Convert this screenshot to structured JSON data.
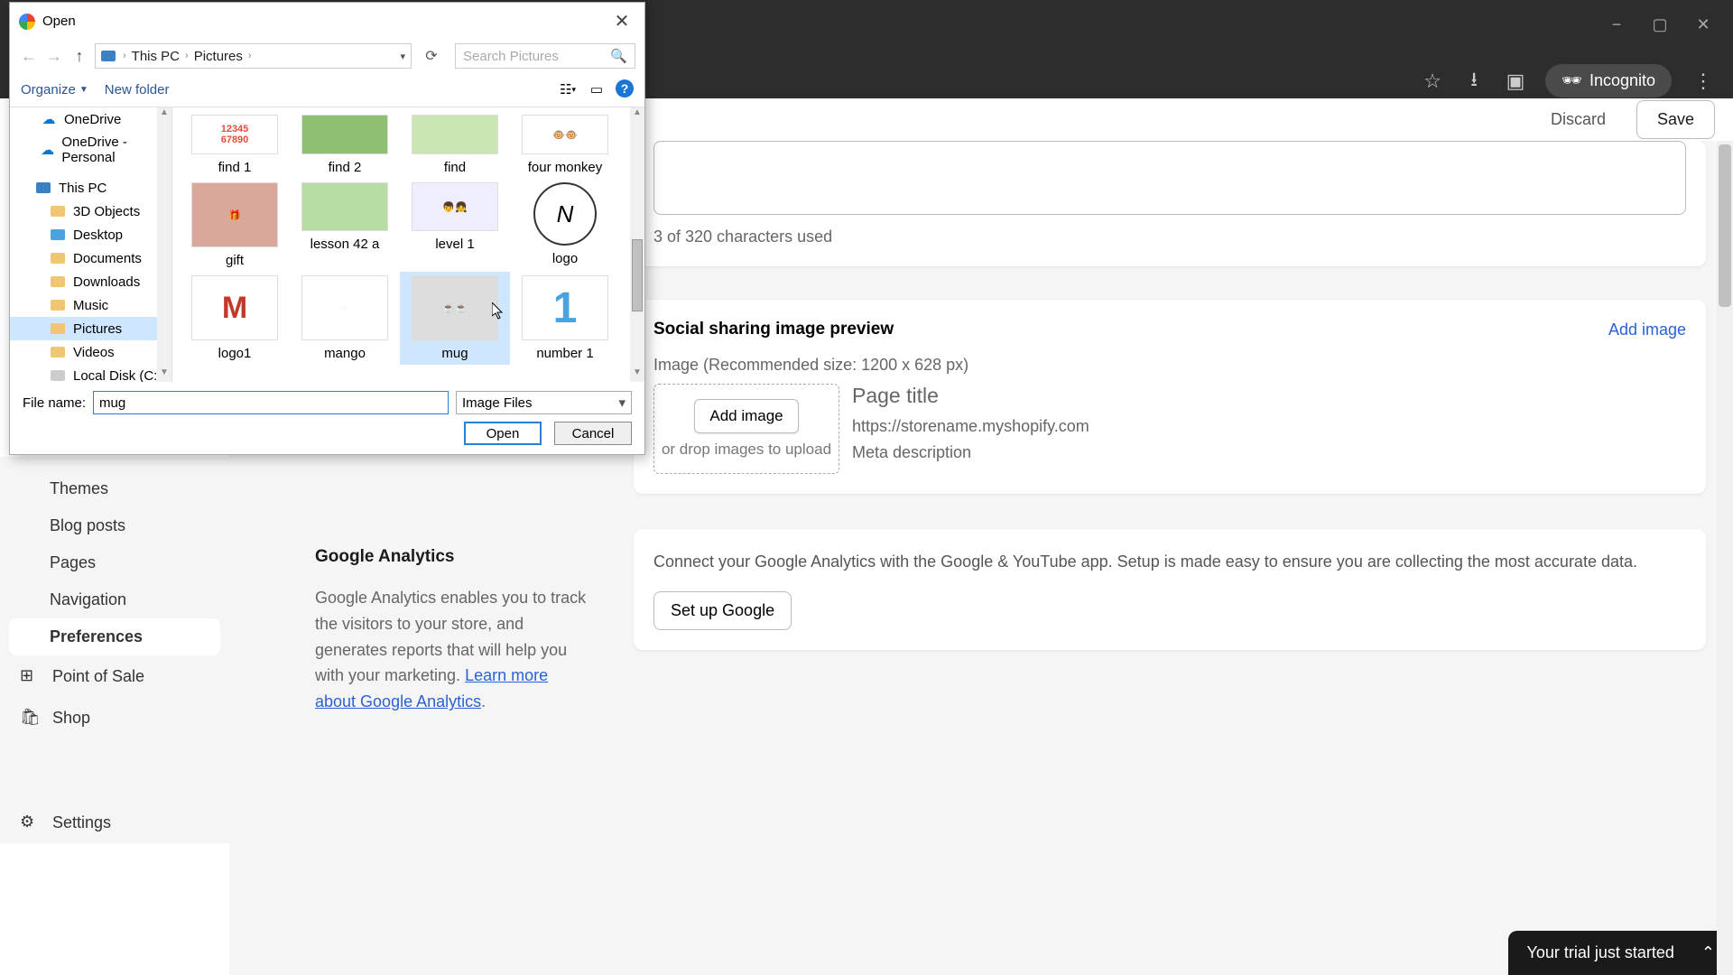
{
  "browser": {
    "incognito_label": "Incognito",
    "window": {
      "minimize": "−",
      "maximize": "▢",
      "close": "✕"
    }
  },
  "top_bar": {
    "discard": "Discard",
    "save": "Save"
  },
  "char_counter": "3 of 320 characters used",
  "social": {
    "heading": "Social sharing image preview",
    "add_image": "Add image",
    "recommend": "Image   (Recommended size: 1200 x 628 px)",
    "drop_btn": "Add image",
    "drop_hint": "or drop images to upload",
    "preview_title": "Page title",
    "preview_url": "https://storename.myshopify.com",
    "preview_meta": "Meta description"
  },
  "ga_left": {
    "title": "Google Analytics",
    "body_a": "Google Analytics enables you to track the visitors to your store, and generates reports that will help you with your marketing. ",
    "link": "Learn more about Google Analytics",
    "dot": "."
  },
  "ga_card": {
    "body": "Connect your Google Analytics with the Google & YouTube app. Setup is made easy to ensure you are collecting the most accurate data.",
    "btn": "Set up Google"
  },
  "sidebar": {
    "items": [
      "Themes",
      "Blog posts",
      "Pages",
      "Navigation",
      "Preferences"
    ],
    "pos": "Point of Sale",
    "shop": "Shop",
    "settings": "Settings"
  },
  "trial": "Your trial just started",
  "dialog": {
    "title": "Open",
    "breadcrumb": [
      "This PC",
      "Pictures"
    ],
    "search_placeholder": "Search Pictures",
    "toolbar": {
      "organize": "Organize",
      "newfolder": "New folder"
    },
    "tree": [
      {
        "label": "OneDrive",
        "type": "onedrive"
      },
      {
        "label": "OneDrive - Personal",
        "type": "onedrive"
      },
      {
        "label": "This PC",
        "type": "pc"
      },
      {
        "label": "3D Objects",
        "type": "folder"
      },
      {
        "label": "Desktop",
        "type": "folder"
      },
      {
        "label": "Documents",
        "type": "folder"
      },
      {
        "label": "Downloads",
        "type": "folder"
      },
      {
        "label": "Music",
        "type": "folder"
      },
      {
        "label": "Pictures",
        "type": "folder",
        "selected": true
      },
      {
        "label": "Videos",
        "type": "folder"
      },
      {
        "label": "Local Disk (C:)",
        "type": "disk"
      }
    ],
    "files": [
      {
        "name": "find 1"
      },
      {
        "name": "find 2"
      },
      {
        "name": "find"
      },
      {
        "name": "four monkey"
      },
      {
        "name": "gift"
      },
      {
        "name": "lesson 42 a"
      },
      {
        "name": "level 1"
      },
      {
        "name": "logo"
      },
      {
        "name": "logo1"
      },
      {
        "name": "mango"
      },
      {
        "name": "mug",
        "selected": true
      },
      {
        "name": "number 1"
      }
    ],
    "file_name_label": "File name:",
    "file_name_value": "mug",
    "file_type": "Image Files",
    "open": "Open",
    "cancel": "Cancel"
  }
}
